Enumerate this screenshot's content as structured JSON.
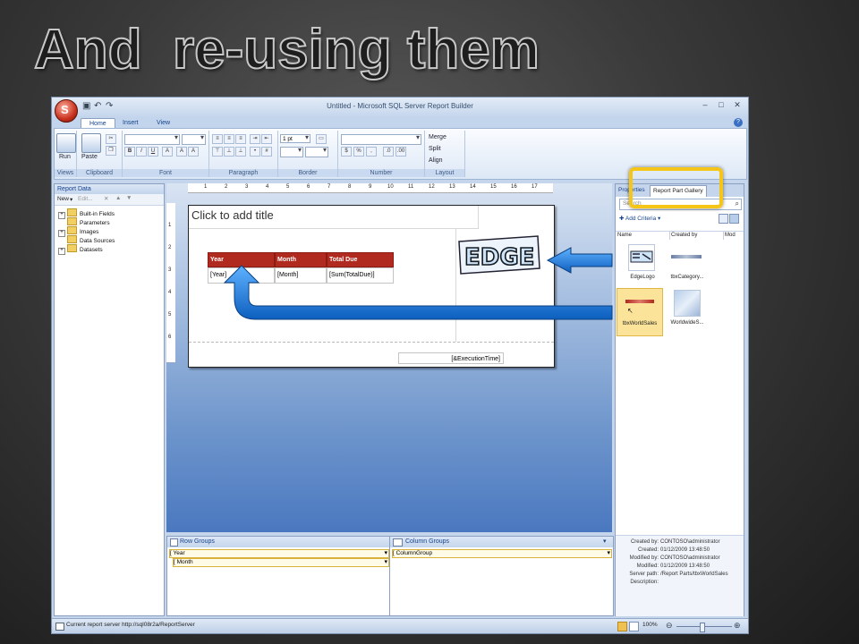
{
  "slide_title": "And  re-using them",
  "window": {
    "title": "Untitled - Microsoft SQL Server Report Builder",
    "orb_glyph": "S",
    "min_glyph": "–",
    "max_glyph": "□",
    "close_glyph": "✕",
    "help_glyph": "?"
  },
  "tabs": [
    "Home",
    "Insert",
    "View"
  ],
  "ribbon": {
    "run_label": "Run",
    "paste_label": "Paste",
    "groups": [
      "Views",
      "Clipboard",
      "Font",
      "Paragraph",
      "Border",
      "Number",
      "Layout"
    ],
    "font_buttons": [
      "B",
      "I",
      "U",
      "A",
      "A",
      "A"
    ],
    "border_size": "1 pt",
    "merge_label": "Merge",
    "split_label": "Split",
    "align_label": "Align"
  },
  "report_data": {
    "header": "Report Data",
    "new_label": "New",
    "edit_label": "Edit...",
    "items": [
      "Built-in Fields",
      "Parameters",
      "Images",
      "Data Sources",
      "Datasets"
    ]
  },
  "ruler": {
    "h_ticks": [
      "1",
      "2",
      "3",
      "4",
      "5",
      "6",
      "7",
      "8",
      "9",
      "10",
      "11",
      "12",
      "13",
      "14",
      "15",
      "16",
      "17"
    ],
    "v_ticks": [
      "1",
      "2",
      "3",
      "4",
      "5",
      "6"
    ]
  },
  "report": {
    "title_placeholder": "Click to add title",
    "table_headers": [
      "Year",
      "Month",
      "Total Due"
    ],
    "table_cells": [
      "[Year]",
      "[Month]",
      "[Sum(TotalDue)]"
    ],
    "footer_expr": "[&ExecutionTime]",
    "logo_text": "EDGE"
  },
  "groups": {
    "row_header": "Row Groups",
    "column_header": "Column Groups",
    "row_items": [
      "[ Year",
      "[ Month"
    ],
    "column_items": [
      "[ ColumnGroup"
    ]
  },
  "gallery": {
    "tab_properties": "Properties",
    "tab_gallery": "Report Part Gallery",
    "search_placeholder": "Search",
    "add_criteria": "Add Criteria",
    "columns": [
      "Name",
      "Created by",
      "Mod"
    ],
    "items": [
      "EdgeLogo",
      "tbxCategory...",
      "tbxWorldSales",
      "WorldwideS..."
    ],
    "selected_item": "tbxWorldSales",
    "metadata": {
      "labels": [
        "Created by:",
        "Created:",
        "Modified by:",
        "Modified:",
        "Server path:",
        "Description:"
      ],
      "values": [
        "CONTOSO\\administrator",
        "01/12/2009 13:48:50",
        "CONTOSO\\administrator",
        "01/12/2009 13:48:50",
        "/Report Parts/tbxWorldSales",
        ""
      ]
    }
  },
  "status": {
    "text": "Current report server http://sql08r2a/ReportServer",
    "zoom": "100%"
  },
  "colors": {
    "highlight": "#f5c518",
    "arrow_blue": "#1d7fe0",
    "header_red": "#b02a20"
  }
}
